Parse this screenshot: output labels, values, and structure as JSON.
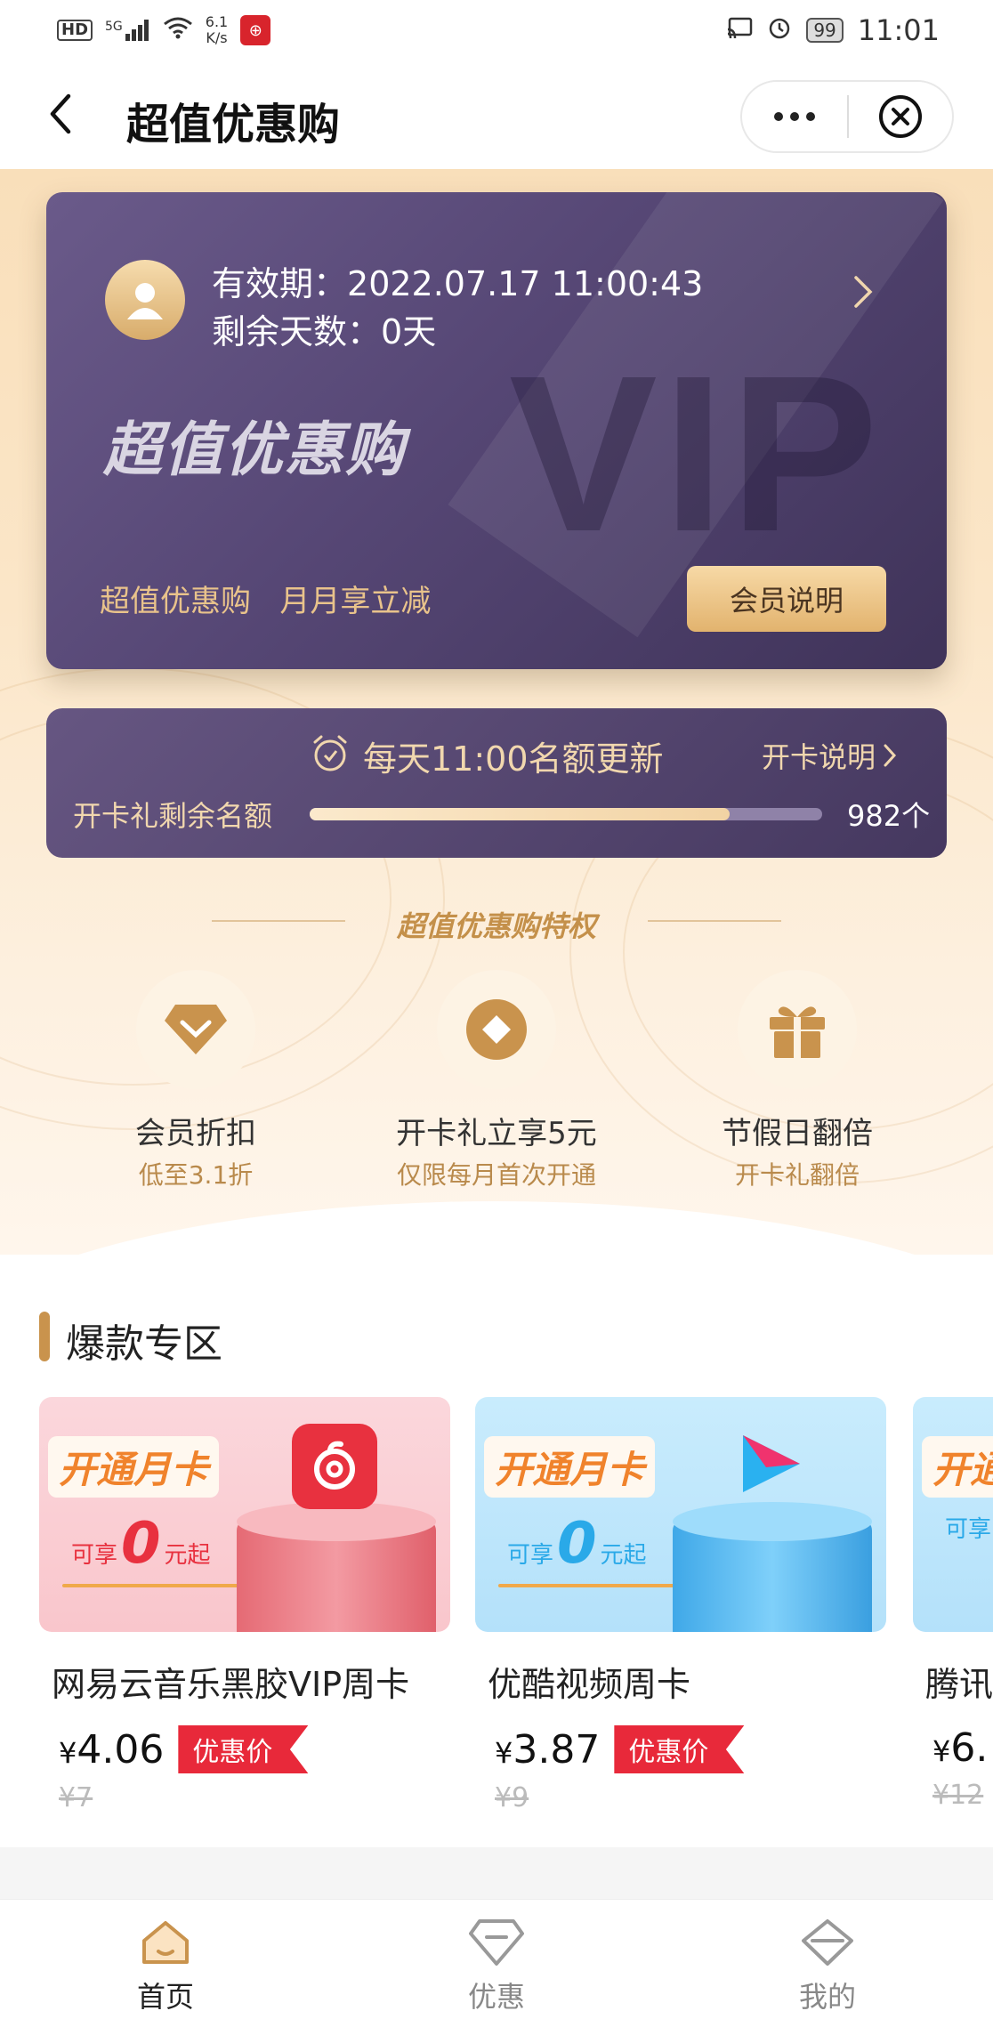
{
  "status_bar": {
    "hd": "HD",
    "signal": "5G",
    "speed_value": "6.1",
    "speed_unit": "K/s",
    "battery": "99",
    "time": "11:01"
  },
  "header": {
    "title": "超值优惠购"
  },
  "vip_card": {
    "valid_label": "有效期：",
    "valid_value": "2022.07.17 11:00:43",
    "days_label": "剩余天数：",
    "days_value": "0天",
    "brand": "超值优惠购",
    "watermark": "VIP",
    "slogan": "超值优惠购   月月享立减",
    "member_button": "会员说明"
  },
  "quota": {
    "title": "每天11:00名额更新",
    "link": "开卡说明",
    "label": "开卡礼剩余名额",
    "progress_percent": 82,
    "count": "982个"
  },
  "privileges": {
    "title": "超值优惠购特权",
    "items": [
      {
        "name": "会员折扣",
        "sub": "低至3.1折",
        "icon": "diamond-icon"
      },
      {
        "name": "开卡礼立享5元",
        "sub": "仅限每月首次开通",
        "icon": "coin-icon"
      },
      {
        "name": "节假日翻倍",
        "sub": "开卡礼翻倍",
        "icon": "gift-icon"
      }
    ]
  },
  "hot_zone": {
    "title": "爆款专区",
    "products": [
      {
        "banner_tag": "开通月卡",
        "banner_pre": "可享",
        "banner_num": "0",
        "banner_post": "元起",
        "name": "网易云音乐黑胶VIP周卡",
        "currency": "¥",
        "price": "4.06",
        "badge": "优惠价",
        "original_price": "¥7",
        "logo": "netease-music-logo",
        "accent": "#e8313f"
      },
      {
        "banner_tag": "开通月卡",
        "banner_pre": "可享",
        "banner_num": "0",
        "banner_post": "元起",
        "name": "优酷视频周卡",
        "currency": "¥",
        "price": "3.87",
        "badge": "优惠价",
        "original_price": "¥9",
        "logo": "youku-logo",
        "accent": "#2aa9e8"
      },
      {
        "banner_tag": "开通",
        "banner_pre": "可享",
        "name": "腾讯",
        "currency": "¥",
        "price": "6.",
        "original_price": "¥12"
      }
    ]
  },
  "tabbar": {
    "items": [
      {
        "label": "首页",
        "icon": "home-icon",
        "active": true
      },
      {
        "label": "优惠",
        "icon": "discount-diamond-icon",
        "active": false
      },
      {
        "label": "我的",
        "icon": "profile-diamond-icon",
        "active": false
      }
    ]
  },
  "colors": {
    "accent_gold": "#c9934d",
    "card_purple": "#564775",
    "deal_red": "#e8293a"
  }
}
